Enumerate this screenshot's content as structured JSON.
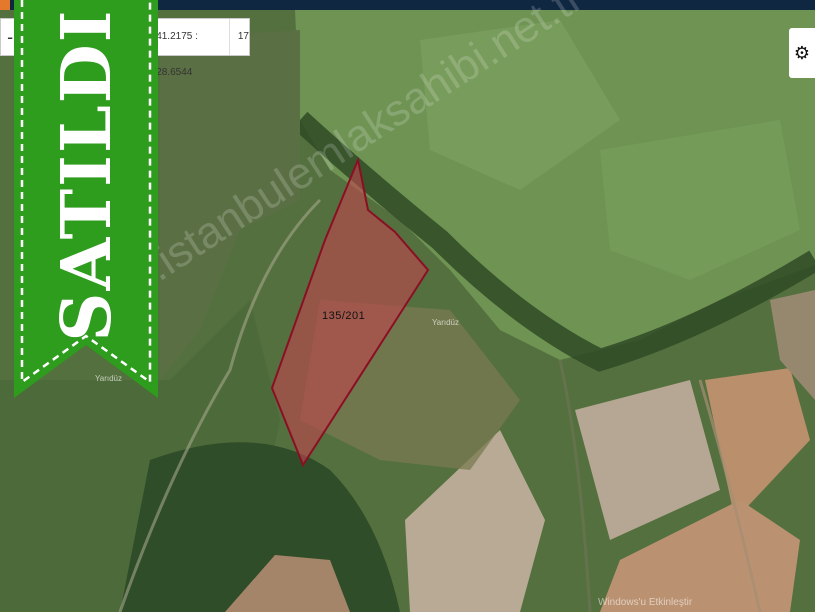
{
  "map": {
    "parcel_label": "135/201",
    "place_label_1": "Yarıdüz",
    "place_label_2": "Yarıdüz",
    "watermark": "www.istanbulemlaksahibi.net.tr"
  },
  "toolbar": {
    "zoom_out": "-",
    "coordinates": "41.2175 : 28.6544",
    "zoom_level": "17",
    "settings_icon": "gear-icon"
  },
  "ribbon": {
    "text": "SATILDI",
    "color": "#2e9c1c"
  },
  "overlay": {
    "windows_text": "Windows'u Etkinleştir"
  },
  "colors": {
    "parcel_fill": "#c0454f",
    "parcel_stroke": "#8b0f24",
    "topbar": "#0f2740"
  }
}
